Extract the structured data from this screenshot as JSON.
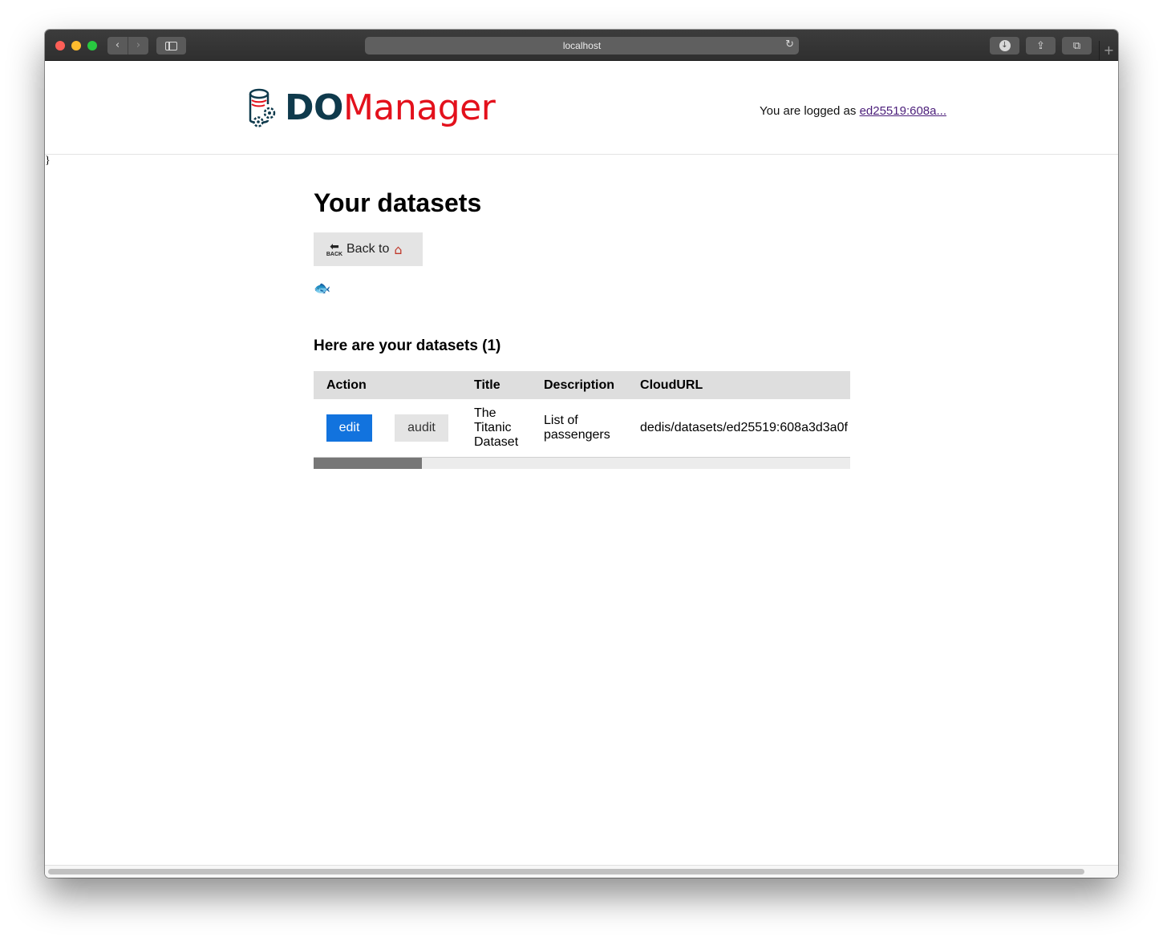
{
  "browser": {
    "url": "localhost",
    "back_glyph": "‹",
    "forward_glyph": "›",
    "reload_glyph": "↻",
    "download_glyph": "↓",
    "share_glyph": "⇪",
    "tabs_glyph": "⧉",
    "new_tab_glyph": "+"
  },
  "header": {
    "logo_do": "DO",
    "logo_manager": "Manager",
    "logged_prefix": "You are logged as ",
    "user_link": "ed25519:608a..."
  },
  "stray_text": "}",
  "page": {
    "title": "Your datasets",
    "back_button": {
      "arrow": "⬅",
      "arrow_word": "BACK",
      "label": "Back to",
      "home_glyph": "⌂"
    },
    "fish_glyph": "🐟",
    "subheading": "Here are your datasets (1)"
  },
  "table": {
    "columns": [
      "Action",
      "Title",
      "Description",
      "CloudURL"
    ],
    "rows": [
      {
        "edit_label": "edit",
        "audit_label": "audit",
        "title": "The Titanic Dataset",
        "description": "List of passengers",
        "cloud_url": "dedis/datasets/ed25519:608a3d3a0f"
      }
    ],
    "scroll_position": 0
  },
  "colors": {
    "accent_blue": "#1273de",
    "logo_dark": "#0f3a4c",
    "logo_red": "#e3111c",
    "visited_link": "#4b1e7a"
  }
}
